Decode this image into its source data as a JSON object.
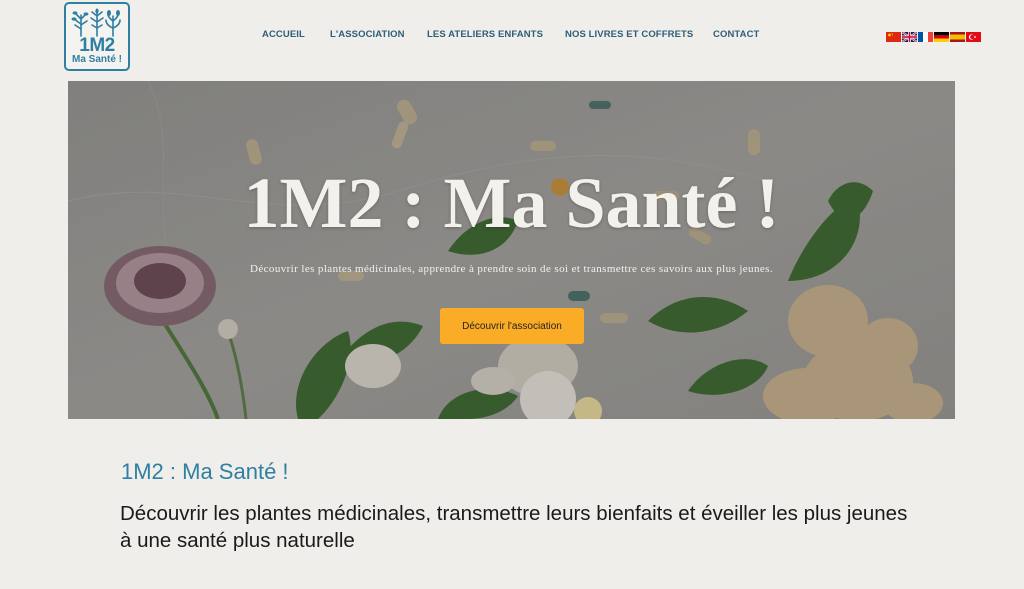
{
  "logo": {
    "line1": "1M2",
    "line2": "Ma Santé !",
    "icon": "plants-icon",
    "color": "#2f7fa2"
  },
  "nav": {
    "items": [
      {
        "label": "ACCUEIL"
      },
      {
        "label": "L'ASSOCIATION"
      },
      {
        "label": "LES ATELIERS ENFANTS"
      },
      {
        "label": "NOS LIVRES ET COFFRETS"
      },
      {
        "label": "CONTACT"
      }
    ]
  },
  "languages": [
    {
      "name": "chinese-flag-icon"
    },
    {
      "name": "uk-flag-icon"
    },
    {
      "name": "french-flag-icon"
    },
    {
      "name": "german-flag-icon"
    },
    {
      "name": "spanish-flag-icon"
    },
    {
      "name": "turkish-flag-icon"
    }
  ],
  "hero": {
    "title": "1M2 : Ma Santé !",
    "subtitle": "Découvrir les plantes médicinales, apprendre à prendre soin de soi et transmettre ces savoirs aux plus jeunes.",
    "button_label": "Découvrir l'association",
    "button_color": "#fbac26"
  },
  "content": {
    "title": "1M2 : Ma Santé !",
    "text": "Découvrir les plantes médicinales, transmettre leurs bienfaits et éveiller les plus jeunes à une santé plus naturelle"
  }
}
